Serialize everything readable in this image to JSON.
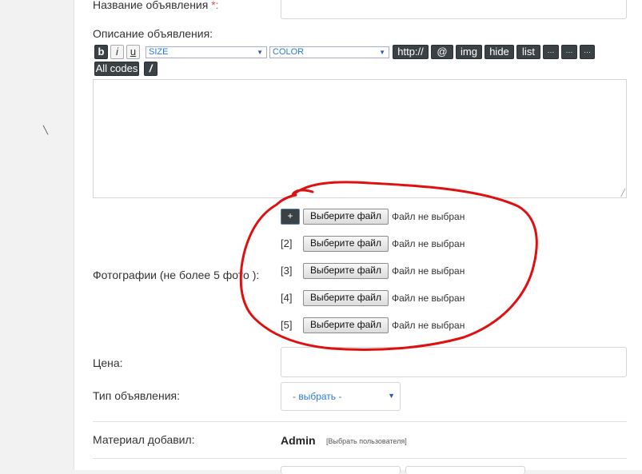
{
  "form": {
    "title_label": "Название объявления",
    "title_required_mark": "*:",
    "description_label": "Описание объявления:",
    "photos_label": "Фотографии (не более 5 фото ):",
    "price_label": "Цена:",
    "type_label": "Тип объявления:",
    "type_select_value": "- выбрать -",
    "added_by_label": "Материал добавил:",
    "added_by_name": "Admin",
    "choose_user_link": "[Выбрать пользователя]"
  },
  "editor": {
    "bold": "b",
    "italic": "i",
    "underline": "u",
    "size_select": "SIZE",
    "color_select": "COLOR",
    "http": "http://",
    "at": "@",
    "img": "img",
    "hide": "hide",
    "list": "list",
    "more1": "···",
    "more2": "···",
    "more3": "···",
    "all_codes": "All codes",
    "slash": "/"
  },
  "photos": {
    "add_button": "+",
    "file_button_label": "Выберите файл",
    "no_file_text": "Файл не выбран",
    "rows": [
      {
        "num": ""
      },
      {
        "num": "[2]"
      },
      {
        "num": "[3]"
      },
      {
        "num": "[4]"
      },
      {
        "num": "[5]"
      }
    ]
  },
  "colors": {
    "required_mark": "#d9534f",
    "dark_button": "#3b4246",
    "select_text": "#2a7bd6",
    "annotation_red": "#e01010"
  }
}
